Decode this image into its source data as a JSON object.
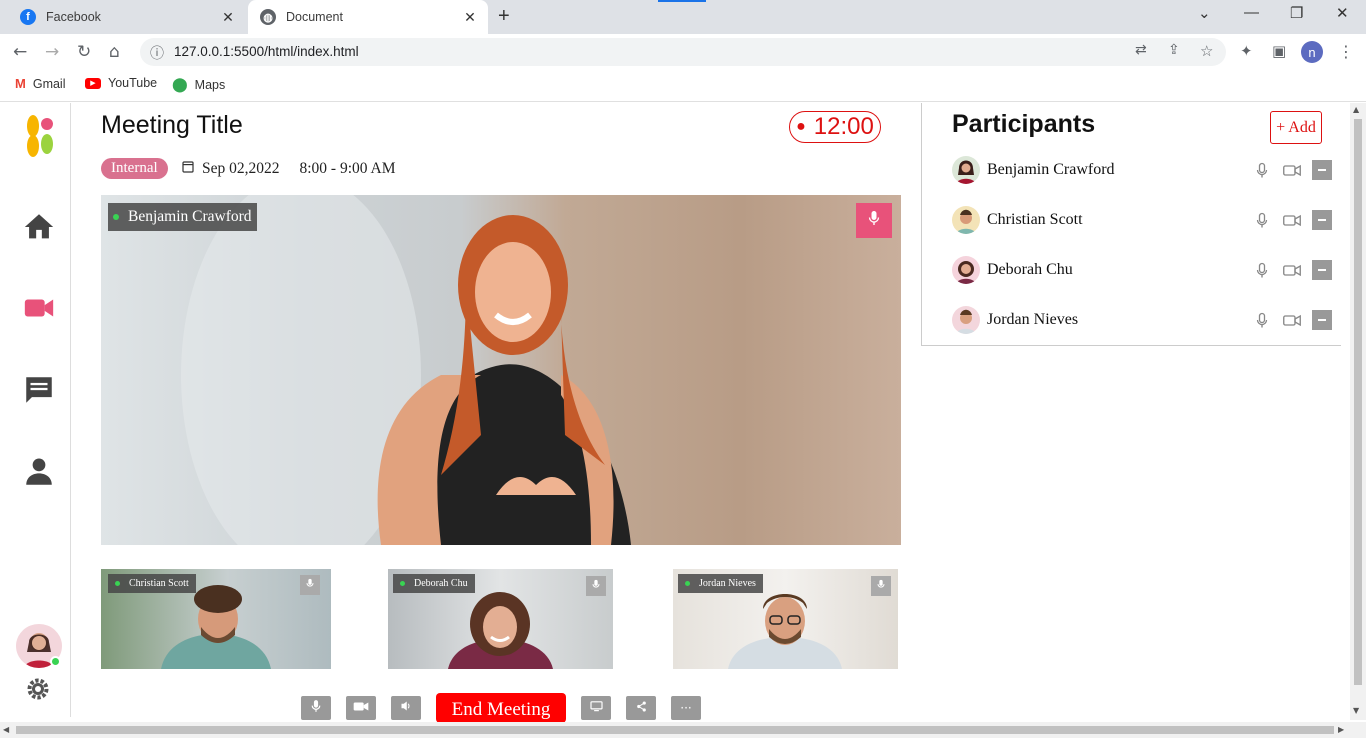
{
  "browser": {
    "tabs": [
      {
        "title": "Facebook"
      },
      {
        "title": "Document"
      }
    ],
    "url": "127.0.0.1:5500/html/index.html",
    "bookmarks": [
      "Gmail",
      "YouTube",
      "Maps"
    ],
    "profile_initial": "n"
  },
  "meeting": {
    "title": "Meeting Title",
    "timer": "12:00",
    "badge": "Internal",
    "date": "Sep 02,2022",
    "time": "8:00 - 9:00 AM",
    "main_speaker": "Benjamin Crawford",
    "thumbnails": [
      {
        "name": "Christian Scott"
      },
      {
        "name": "Deborah Chu"
      },
      {
        "name": "Jordan Nieves"
      }
    ],
    "end_label": "End Meeting"
  },
  "participants": {
    "title": "Participants",
    "add_label": "+ Add",
    "list": [
      {
        "name": "Benjamin Crawford"
      },
      {
        "name": "Christian Scott"
      },
      {
        "name": "Deborah Chu"
      },
      {
        "name": "Jordan Nieves"
      }
    ]
  },
  "colors": {
    "accent": "#e8527a",
    "danger": "#ff0000",
    "badge": "#d9718f"
  },
  "icons": {
    "sidebar": [
      "home-icon",
      "video-icon",
      "chat-icon",
      "user-icon",
      "settings-icon"
    ],
    "controls": [
      "mic-icon",
      "camera-icon",
      "volume-icon",
      "screen-icon",
      "share-icon",
      "more-icon"
    ]
  }
}
